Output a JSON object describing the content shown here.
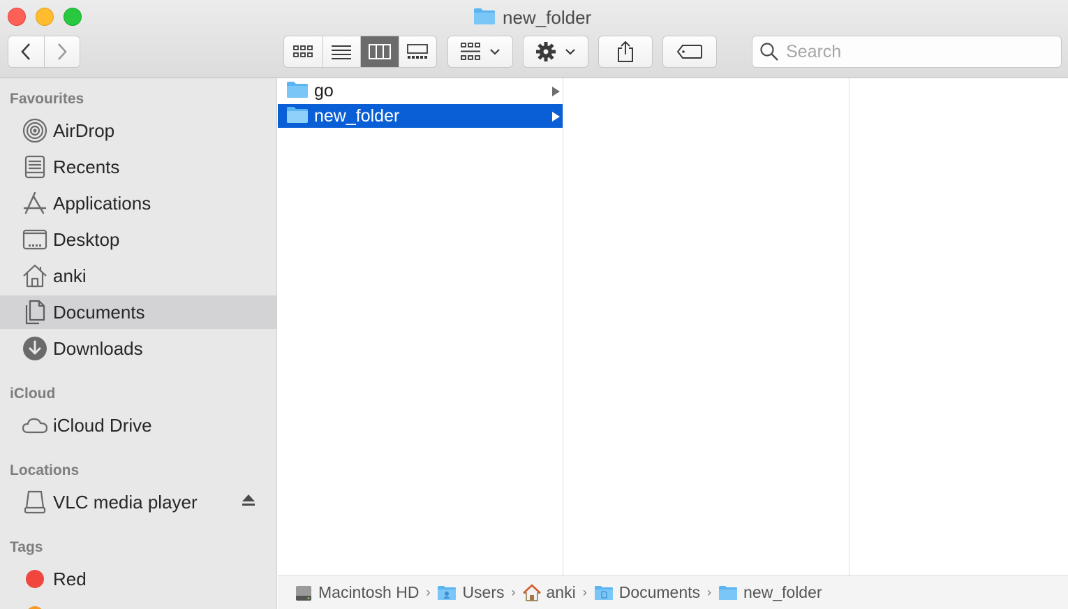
{
  "window": {
    "title": "new_folder"
  },
  "toolbar": {
    "back_icon": "chevron-left-icon",
    "forward_icon": "chevron-right-icon",
    "view_modes": [
      "icon-view",
      "list-view",
      "column-view",
      "gallery-view"
    ],
    "active_view": "column-view",
    "search_placeholder": "Search"
  },
  "sidebar": {
    "favourites_header": "Favourites",
    "favourites": [
      {
        "label": "AirDrop",
        "icon": "airdrop-icon"
      },
      {
        "label": "Recents",
        "icon": "recents-icon"
      },
      {
        "label": "Applications",
        "icon": "applications-icon"
      },
      {
        "label": "Desktop",
        "icon": "desktop-icon"
      },
      {
        "label": "anki",
        "icon": "home-icon"
      },
      {
        "label": "Documents",
        "icon": "documents-icon",
        "selected": true
      },
      {
        "label": "Downloads",
        "icon": "downloads-icon"
      }
    ],
    "icloud_header": "iCloud",
    "icloud": [
      {
        "label": "iCloud Drive",
        "icon": "cloud-icon"
      }
    ],
    "locations_header": "Locations",
    "locations": [
      {
        "label": "VLC media player",
        "icon": "disk-icon"
      }
    ],
    "tags_header": "Tags",
    "tags": [
      {
        "label": "Red",
        "color": "#f0463e"
      }
    ]
  },
  "columns": {
    "column1": [
      {
        "name": "go",
        "selected": false
      },
      {
        "name": "new_folder",
        "selected": true
      }
    ]
  },
  "pathbar": {
    "items": [
      {
        "label": "Macintosh HD",
        "icon": "hard-drive-icon"
      },
      {
        "label": "Users",
        "icon": "users-folder-icon"
      },
      {
        "label": "anki",
        "icon": "home-icon"
      },
      {
        "label": "Documents",
        "icon": "documents-folder-icon"
      },
      {
        "label": "new_folder",
        "icon": "folder-icon"
      }
    ]
  }
}
